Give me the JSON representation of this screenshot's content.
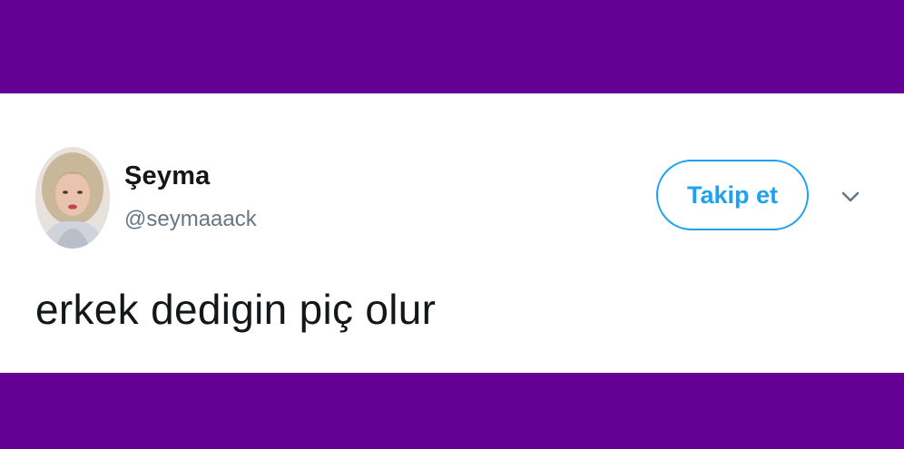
{
  "colors": {
    "band": "#650094",
    "accent": "#1da1f2",
    "text_primary": "#14171a",
    "text_secondary": "#657786"
  },
  "tweet": {
    "author": {
      "display_name": "Şeyma",
      "handle": "@seymaaack",
      "avatar_icon": "profile-photo"
    },
    "follow_label": "Takip et",
    "menu_icon": "chevron-down-icon",
    "text": "erkek dedigin piç olur"
  }
}
